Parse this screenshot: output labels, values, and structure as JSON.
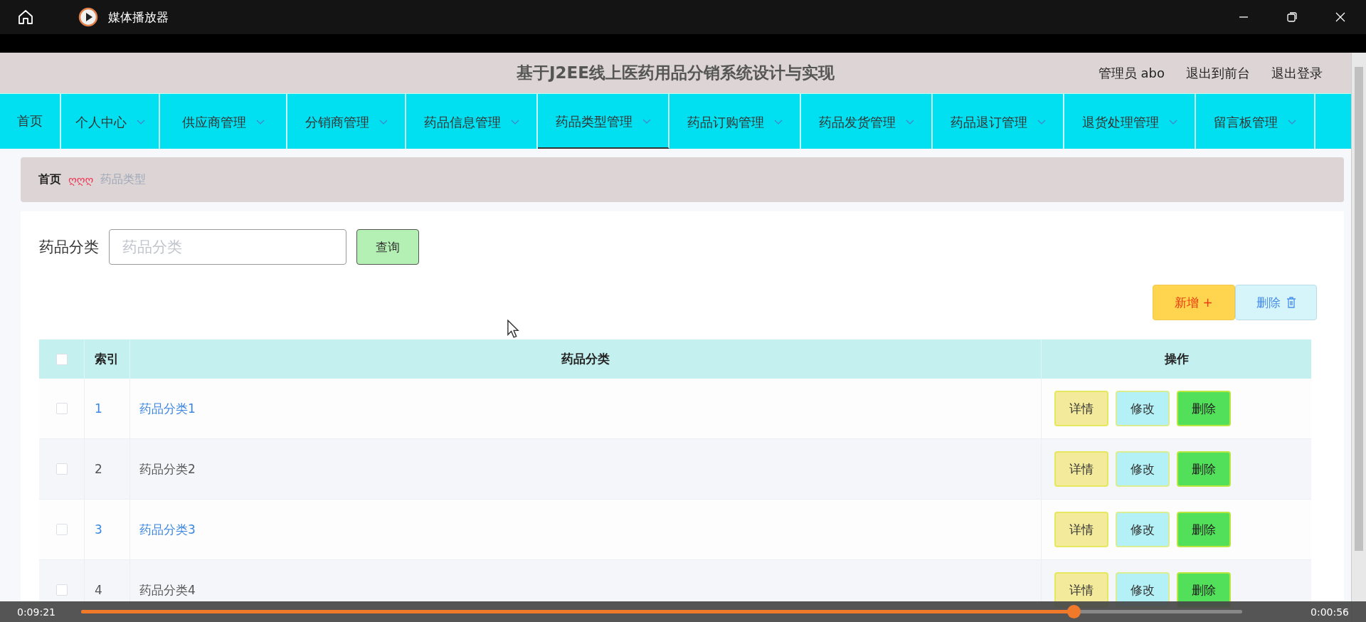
{
  "window": {
    "title": "媒体播放器"
  },
  "header": {
    "title": "基于J2EE线上医药用品分销系统设计与实现",
    "links": [
      "管理员 abo",
      "退出到前台",
      "退出登录"
    ]
  },
  "nav": [
    {
      "label": "首页",
      "dropdown": false,
      "selected": false
    },
    {
      "label": "个人中心",
      "dropdown": true,
      "selected": false
    },
    {
      "label": "供应商管理",
      "dropdown": true,
      "selected": false
    },
    {
      "label": "分销商管理",
      "dropdown": true,
      "selected": false
    },
    {
      "label": "药品信息管理",
      "dropdown": true,
      "selected": false
    },
    {
      "label": "药品类型管理",
      "dropdown": true,
      "selected": true
    },
    {
      "label": "药品订购管理",
      "dropdown": true,
      "selected": false
    },
    {
      "label": "药品发货管理",
      "dropdown": true,
      "selected": false
    },
    {
      "label": "药品退订管理",
      "dropdown": true,
      "selected": false
    },
    {
      "label": "退货处理管理",
      "dropdown": true,
      "selected": false
    },
    {
      "label": "留言板管理",
      "dropdown": true,
      "selected": false
    }
  ],
  "breadcrumb": {
    "home": "首页",
    "separator": "ღღღ",
    "current": "药品类型"
  },
  "search": {
    "label": "药品分类",
    "placeholder": "药品分类",
    "button": "查询"
  },
  "actions": {
    "add": "新增 +",
    "delete": "删除"
  },
  "table": {
    "select_all_checked": false,
    "columns": [
      "索引",
      "药品分类",
      "操作"
    ],
    "rows": [
      {
        "index": "1",
        "name": "药品分类1",
        "highlighted": true,
        "checked": false,
        "buttons": [
          "详情",
          "修改",
          "删除"
        ]
      },
      {
        "index": "2",
        "name": "药品分类2",
        "highlighted": false,
        "checked": false,
        "buttons": [
          "详情",
          "修改",
          "删除"
        ]
      },
      {
        "index": "3",
        "name": "药品分类3",
        "highlighted": true,
        "checked": false,
        "buttons": [
          "详情",
          "修改",
          "删除"
        ]
      },
      {
        "index": "4",
        "name": "药品分类4",
        "highlighted": false,
        "checked": false,
        "buttons": [
          "详情",
          "修改",
          "删除"
        ]
      }
    ]
  },
  "player": {
    "elapsed": "0:09:21",
    "remaining": "0:00:56",
    "level": 0.855
  }
}
